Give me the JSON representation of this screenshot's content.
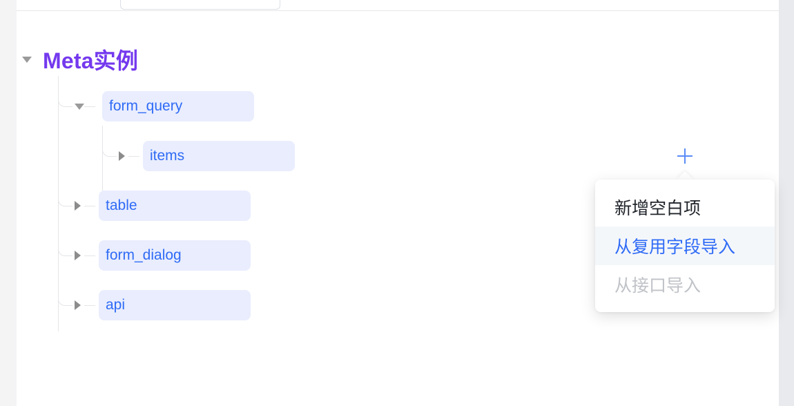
{
  "toolbar": {
    "search_value": "",
    "search_placeholder": ""
  },
  "tree": {
    "root": {
      "label": "Meta实例",
      "expanded": true,
      "caret_icon": "caret-down-icon",
      "color": "#7439ee"
    },
    "nodes": [
      {
        "label": "form_query",
        "level": 1,
        "expanded": true,
        "caret_icon": "caret-down-icon"
      },
      {
        "label": "items",
        "level": 2,
        "expanded": false,
        "caret_icon": "caret-right-icon"
      },
      {
        "label": "table",
        "level": 1,
        "expanded": false,
        "caret_icon": "caret-right-icon"
      },
      {
        "label": "form_dialog",
        "level": 1,
        "expanded": false,
        "caret_icon": "caret-right-icon"
      },
      {
        "label": "api",
        "level": 1,
        "expanded": false,
        "caret_icon": "caret-right-icon"
      }
    ],
    "pill_bg": "#e9edfd",
    "pill_text_color": "#2f6bf6",
    "line_color": "#e4e5e8"
  },
  "add_control": {
    "icon": "plus-icon",
    "icon_color": "#5b8bf7"
  },
  "popup_menu": {
    "items": [
      {
        "label": "新增空白项",
        "state": "normal"
      },
      {
        "label": "从复用字段导入",
        "state": "active"
      },
      {
        "label": "从接口导入",
        "state": "disabled"
      }
    ],
    "active_color": "#2f6bf6",
    "disabled_color": "#bfc2c7"
  }
}
